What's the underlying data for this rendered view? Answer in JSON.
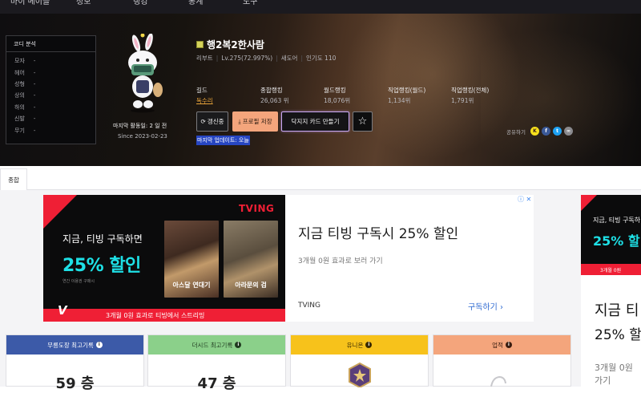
{
  "nav": {
    "items": [
      "마이 메이플",
      "정보",
      "랭킹",
      "통계",
      "도구"
    ]
  },
  "coordi": {
    "title": "코디 분석",
    "rows": [
      {
        "label": "모자",
        "value": "-"
      },
      {
        "label": "헤어",
        "value": "-"
      },
      {
        "label": "성형",
        "value": "-"
      },
      {
        "label": "상의",
        "value": "-"
      },
      {
        "label": "하의",
        "value": "-"
      },
      {
        "label": "신발",
        "value": "-"
      },
      {
        "label": "무기",
        "value": "-"
      }
    ]
  },
  "profile": {
    "last_active": "마지막 활동일: 2 일 전",
    "since": "Since 2023-02-23",
    "name": "행2복2한사람",
    "job": "리부트",
    "level": "Lv.275(72.997%)",
    "guild_name": "새도어",
    "popularity": "인기도 110",
    "stats": [
      {
        "label": "길드",
        "value": "독수리"
      },
      {
        "label": "종합랭킹",
        "value": "26,063 위"
      },
      {
        "label": "월드랭킹",
        "value": "18,076위"
      },
      {
        "label": "직업랭킹(월드)",
        "value": "1,134위"
      },
      {
        "label": "직업랭킹(전체)",
        "value": "1,791위"
      }
    ],
    "buttons": {
      "refresh": "갱신중",
      "save": "프로필 저장",
      "card": "닥지지 카드 만들기",
      "star": "☆"
    },
    "last_update": "마지막 업데이트: 오늘",
    "share_label": "공유하기"
  },
  "tabs": {
    "total": "종합"
  },
  "ad": {
    "brand_logo": "TVING",
    "left_line1": "지금, 티빙 구독하면",
    "left_line2": "25% 할인",
    "left_line3": "연간 이용권 구매시",
    "bottom_bar": "3개월 0원 효과로 티빙에서 스트리밍",
    "v_logo": "V",
    "poster1_title": "아스달 연대기",
    "poster2_title": "아라문의 검",
    "right_title": "지금 티빙 구독시 25% 할인",
    "right_sub": "3개월 0원 효과로 보러 가기",
    "right_brand": "TVING",
    "right_cta": "구독하기 ›",
    "close_marks": "ⓘ ✕",
    "side_line1": "지금, 티빙 구독하",
    "side_line2": "25% 할",
    "side_bottom": "3개월 0원",
    "side_text1": "지금 티",
    "side_text2": "25% 할",
    "side_text3": "3개월 0원",
    "side_text4": "가기"
  },
  "cards": [
    {
      "title": "무릉도장 최고기록",
      "value": "59 층",
      "color": "#3c5aa8"
    },
    {
      "title": "더시드 최고기록",
      "value": "47 층",
      "color": "#8bd08a"
    },
    {
      "title": "유니온",
      "value": "",
      "color": "#f7c21b"
    },
    {
      "title": "업적",
      "value": "",
      "color": "#f4a57c"
    }
  ]
}
